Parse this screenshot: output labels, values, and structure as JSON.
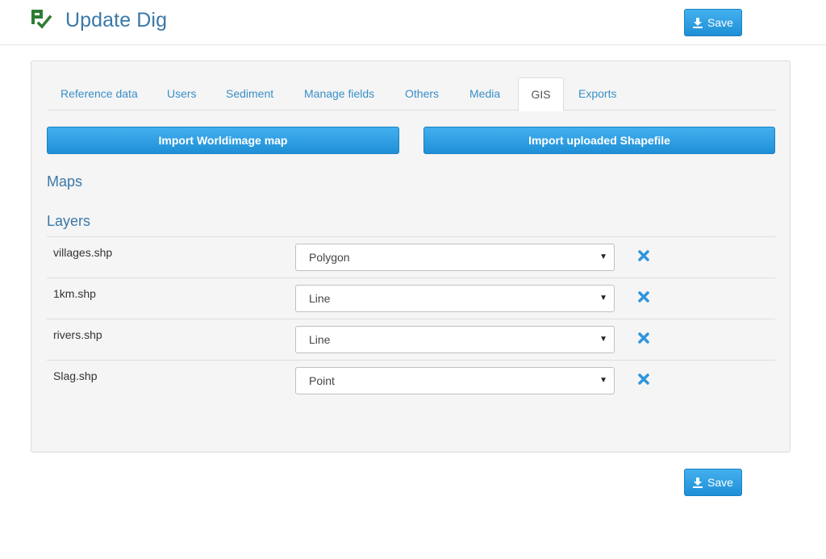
{
  "header": {
    "title": "Update Dig",
    "save_label": "Save",
    "logo_icon": "save-check-icon",
    "brand_color": "#3a78a8",
    "logo_color": "#2e7d32"
  },
  "tabs": [
    {
      "label": "Reference data"
    },
    {
      "label": "Users"
    },
    {
      "label": "Sediment"
    },
    {
      "label": "Manage fields"
    },
    {
      "label": "Others"
    },
    {
      "label": "Media"
    },
    {
      "label": "GIS",
      "active": true
    },
    {
      "label": "Exports"
    }
  ],
  "gis": {
    "import_worldimage_label": "Import Worldimage map",
    "import_shapefile_label": "Import uploaded Shapefile",
    "maps_heading": "Maps",
    "layers_heading": "Layers",
    "layers": [
      {
        "name": "villages.shp",
        "type": "Polygon"
      },
      {
        "name": "1km.shp",
        "type": "Line"
      },
      {
        "name": "rivers.shp",
        "type": "Line"
      },
      {
        "name": "Slag.shp",
        "type": "Point"
      }
    ],
    "remove_icon": "close-icon",
    "accent_color": "#2e95dd"
  },
  "footer": {
    "save_label": "Save"
  }
}
